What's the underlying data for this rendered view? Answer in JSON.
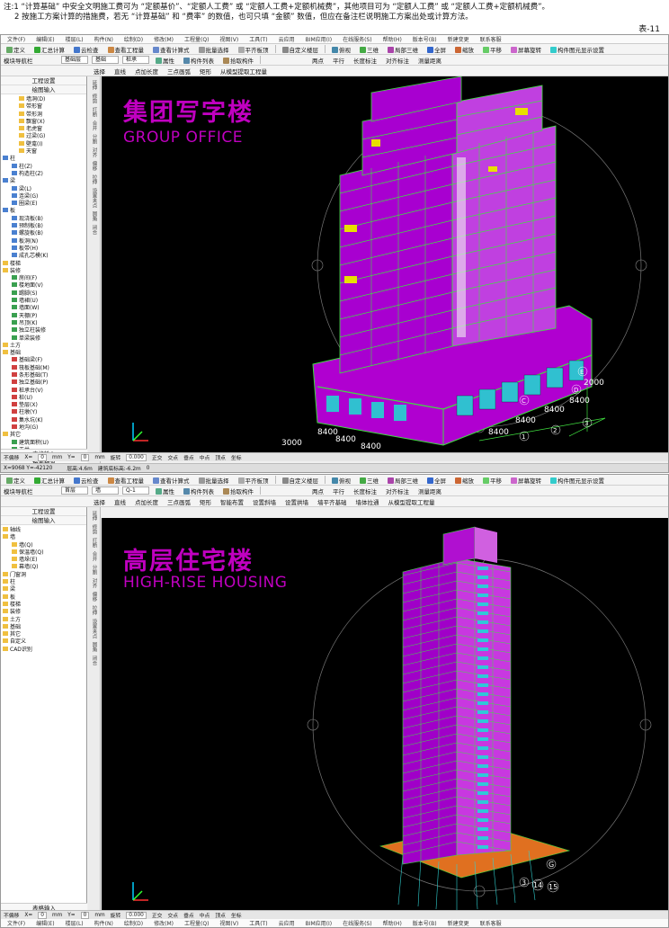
{
  "note": {
    "line1": "注:1 “计算基础” 中安全文明施工费可为 “定额基价”、“定额人工费” 或 “定额人工费+定额机械费”，其他项目可为 “定额人工费” 或 “定额人工费+定额机械费”。",
    "line2": "2 按施工方案计算的措施费，若无 “计算基础” 和 “费率” 的数值，也可只填 “金额” 数值，但应在备注栏说明施工方案出处或计算方法。",
    "page_label": "表-11"
  },
  "app": {
    "menu": [
      "文件(F)",
      "编辑(E)",
      "楼层(L)",
      "构件(N)",
      "绘制(D)",
      "修改(M)",
      "工程量(Q)",
      "视图(V)",
      "工具(T)",
      "云应用",
      "BIM应用(I)",
      "在线服务(S)",
      "帮助(H)",
      "版本号(B)",
      "新建变更",
      "联系客服"
    ],
    "toolbar1": [
      "定义",
      "汇总计算",
      "云检查",
      "查看工程量",
      "查看计算式",
      "批量选择",
      "平齐板顶",
      "自定义楼层",
      "俯视",
      "三维",
      "局部三维",
      "全屏",
      "缩放",
      "平移",
      "屏幕旋转",
      "构件图元显示设置"
    ],
    "toolbar2_s1": [
      "基础层",
      "基础",
      "桩承",
      "属性",
      "构件列表",
      "拾取构件",
      "两点",
      "平行",
      "长度标注",
      "对齐标注",
      "测量距离"
    ],
    "toolbar3_s1": [
      "选择",
      "直线",
      "点加长度",
      "三点画弧",
      "矩形",
      "从模型提取工程量"
    ],
    "toolbar2_s2": [
      "首层",
      "墙",
      "Q-1",
      "属性",
      "构件列表",
      "拾取构件",
      "两点",
      "平行",
      "长度标注",
      "对齐标注",
      "测量距离"
    ],
    "toolbar3_s2": [
      "选择",
      "直线",
      "点加长度",
      "三点画弧",
      "矩形",
      "智能布置",
      "设置斜墙",
      "设置拱墙",
      "墙平齐基础",
      "墙体拉通",
      "从模型提取工程量"
    ],
    "sidebar_title": "模块导航栏",
    "project_settings": "工程设置",
    "drawing_input": "绘图输入",
    "table_input": "表格输入",
    "report_preview": "报表预览",
    "vstrip": [
      "延伸",
      "修剪",
      "打断",
      "合并",
      "分割",
      "对齐",
      "偏移",
      "拉伸",
      "设置夹点",
      "圆角",
      "闭合"
    ]
  },
  "screen1": {
    "title_cn": "集团写字楼",
    "title_en": "GROUP OFFICE",
    "tree": [
      {
        "level": 3,
        "text": "墙洞(D)",
        "color": "y"
      },
      {
        "level": 3,
        "text": "带形窗",
        "color": "y"
      },
      {
        "level": 3,
        "text": "带形洞",
        "color": "y"
      },
      {
        "level": 3,
        "text": "飘窗(X)",
        "color": "y"
      },
      {
        "level": 3,
        "text": "老虎窗",
        "color": "y"
      },
      {
        "level": 3,
        "text": "过梁(G)",
        "color": "y"
      },
      {
        "level": 3,
        "text": "壁龛(I)",
        "color": "y"
      },
      {
        "level": 3,
        "text": "天窗",
        "color": "y"
      },
      {
        "level": 1,
        "text": "柱",
        "color": "b"
      },
      {
        "level": 2,
        "text": "柱(Z)",
        "color": "b"
      },
      {
        "level": 2,
        "text": "构造柱(Z)",
        "color": "b"
      },
      {
        "level": 1,
        "text": "梁",
        "color": "b"
      },
      {
        "level": 2,
        "text": "梁(L)",
        "color": "b"
      },
      {
        "level": 2,
        "text": "连梁(G)",
        "color": "b"
      },
      {
        "level": 2,
        "text": "圈梁(E)",
        "color": "b"
      },
      {
        "level": 1,
        "text": "板",
        "color": "b"
      },
      {
        "level": 2,
        "text": "现浇板(B)",
        "color": "b"
      },
      {
        "level": 2,
        "text": "预制板(B)",
        "color": "b"
      },
      {
        "level": 2,
        "text": "螺旋板(B)",
        "color": "b"
      },
      {
        "level": 2,
        "text": "板洞(N)",
        "color": "b"
      },
      {
        "level": 2,
        "text": "板带(H)",
        "color": "b"
      },
      {
        "level": 2,
        "text": "成孔芯模(K)",
        "color": "b"
      },
      {
        "level": 1,
        "text": "楼梯",
        "color": "y"
      },
      {
        "level": 1,
        "text": "装修",
        "color": "y"
      },
      {
        "level": 2,
        "text": "房间(F)",
        "color": "g"
      },
      {
        "level": 2,
        "text": "楼地面(V)",
        "color": "g"
      },
      {
        "level": 2,
        "text": "踢脚(S)",
        "color": "g"
      },
      {
        "level": 2,
        "text": "墙裙(U)",
        "color": "g"
      },
      {
        "level": 2,
        "text": "墙面(W)",
        "color": "g"
      },
      {
        "level": 2,
        "text": "天棚(P)",
        "color": "g"
      },
      {
        "level": 2,
        "text": "吊顶(K)",
        "color": "g"
      },
      {
        "level": 2,
        "text": "独立柱装修",
        "color": "g"
      },
      {
        "level": 2,
        "text": "单梁装修",
        "color": "g"
      },
      {
        "level": 1,
        "text": "土方",
        "color": "y"
      },
      {
        "level": 1,
        "text": "基础",
        "color": "y"
      },
      {
        "level": 2,
        "text": "基础梁(F)",
        "color": "r"
      },
      {
        "level": 2,
        "text": "筏板基础(M)",
        "color": "r"
      },
      {
        "level": 2,
        "text": "条形基础(T)",
        "color": "r"
      },
      {
        "level": 2,
        "text": "独立基础(P)",
        "color": "r"
      },
      {
        "level": 2,
        "text": "桩承台(V)",
        "color": "r"
      },
      {
        "level": 2,
        "text": "桩(U)",
        "color": "r"
      },
      {
        "level": 2,
        "text": "垫层(X)",
        "color": "r"
      },
      {
        "level": 2,
        "text": "柱墩(Y)",
        "color": "r"
      },
      {
        "level": 2,
        "text": "集水坑(K)",
        "color": "r"
      },
      {
        "level": 2,
        "text": "地沟(G)",
        "color": "r"
      },
      {
        "level": 1,
        "text": "其它",
        "color": "y"
      },
      {
        "level": 2,
        "text": "建筑面积(U)",
        "color": "g"
      },
      {
        "level": 2,
        "text": "天井",
        "color": "g"
      },
      {
        "level": 2,
        "text": "平整场地(V)",
        "color": "g"
      },
      {
        "level": 2,
        "text": "散水(S)",
        "color": "g"
      }
    ],
    "dims": [
      "2000",
      "8400",
      "8400",
      "8400",
      "8400",
      "3000",
      "8400",
      "8400",
      "8400"
    ],
    "axis_labels": [
      "E",
      "D",
      "C",
      "1",
      "2",
      "3"
    ],
    "status": [
      "不偏移",
      "X=",
      "0",
      "mm",
      "Y=",
      "0",
      "mm",
      "旋转",
      "0.000",
      "正交",
      "交点",
      "垂点",
      "中点",
      "顶点",
      "坐标"
    ],
    "bottom_info": [
      "X=9068  Y=-42120",
      "层高:4.6m",
      "建筑底标高:-6.2m",
      "0"
    ]
  },
  "screen2": {
    "title_cn": "高层住宅楼",
    "title_en": "HIGH-RISE HOUSING",
    "tree": [
      {
        "level": 1,
        "text": "轴线",
        "color": "y"
      },
      {
        "level": 1,
        "text": "墙",
        "color": "y"
      },
      {
        "level": 2,
        "text": "墙(Q)",
        "color": "y"
      },
      {
        "level": 2,
        "text": "保温墙(Q)",
        "color": "y"
      },
      {
        "level": 2,
        "text": "墙垛(E)",
        "color": "y"
      },
      {
        "level": 2,
        "text": "幕墙(Q)",
        "color": "y"
      },
      {
        "level": 1,
        "text": "门窗洞",
        "color": "y"
      },
      {
        "level": 1,
        "text": "柱",
        "color": "y"
      },
      {
        "level": 1,
        "text": "梁",
        "color": "y"
      },
      {
        "level": 1,
        "text": "板",
        "color": "y"
      },
      {
        "level": 1,
        "text": "楼梯",
        "color": "y"
      },
      {
        "level": 1,
        "text": "装修",
        "color": "y"
      },
      {
        "level": 1,
        "text": "土方",
        "color": "y"
      },
      {
        "level": 1,
        "text": "基础",
        "color": "y"
      },
      {
        "level": 1,
        "text": "其它",
        "color": "y"
      },
      {
        "level": 1,
        "text": "自定义",
        "color": "y"
      },
      {
        "level": 1,
        "text": "CAD识别",
        "color": "y"
      }
    ],
    "axis_labels": [
      "3",
      "14",
      "15",
      "G"
    ],
    "status": [
      "不偏移",
      "X=",
      "0",
      "mm",
      "Y=",
      "0",
      "mm",
      "旋转",
      "0.000",
      "正交",
      "交点",
      "垂点",
      "中点",
      "顶点",
      "坐标"
    ]
  },
  "colors": {
    "magenta": "#c000c0",
    "building": "#b000d0",
    "accent_green": "#40e040",
    "canvas_bg": "#000000"
  }
}
